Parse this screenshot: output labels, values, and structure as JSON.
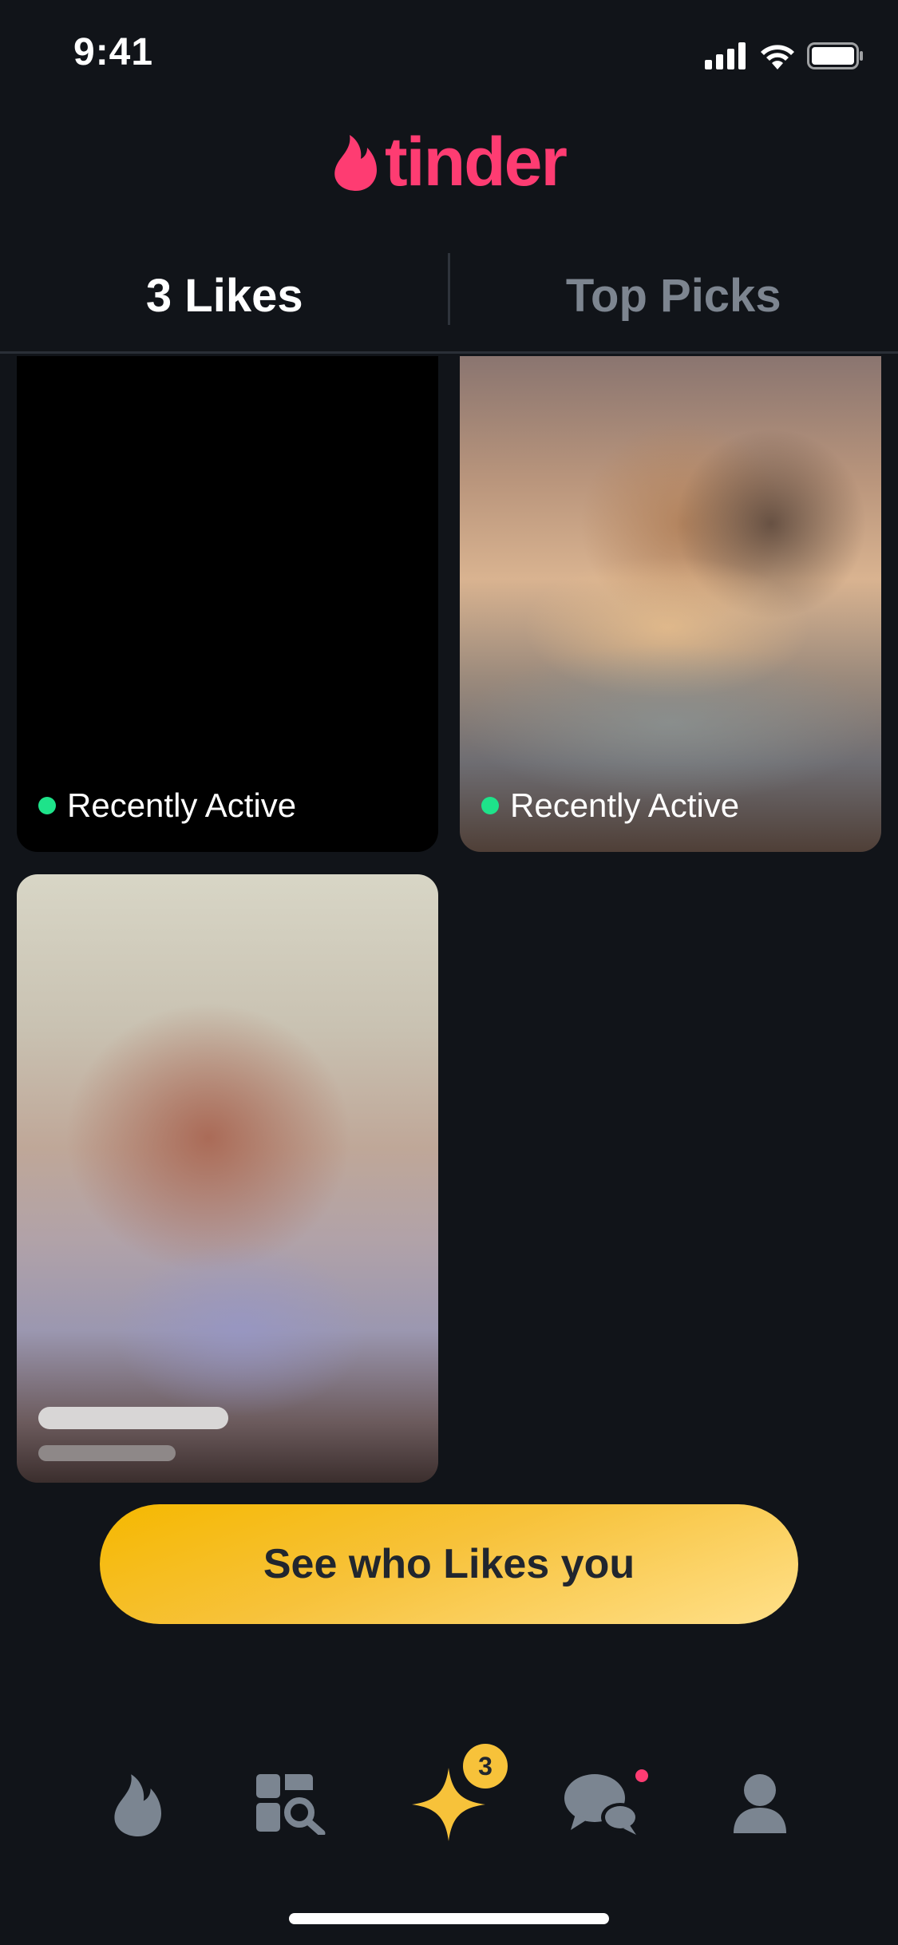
{
  "status_bar": {
    "time": "9:41"
  },
  "app": {
    "logo_text": "tinder",
    "brand_color": "#fe3c72",
    "accent_gold": "#f7c23a",
    "online_green": "#1ee38a"
  },
  "tabs": [
    {
      "label": "3 Likes",
      "active": true
    },
    {
      "label": "Top Picks",
      "active": false
    }
  ],
  "cards": [
    {
      "status": "Recently Active"
    },
    {
      "status": "Recently Active"
    },
    {
      "status": ""
    }
  ],
  "cta": {
    "label": "See who Likes you"
  },
  "bottom_nav": {
    "items": [
      {
        "icon": "flame-icon"
      },
      {
        "icon": "explore-icon"
      },
      {
        "icon": "sparkle-icon",
        "badge": "3"
      },
      {
        "icon": "chat-icon",
        "notification": true
      },
      {
        "icon": "profile-icon"
      }
    ]
  }
}
